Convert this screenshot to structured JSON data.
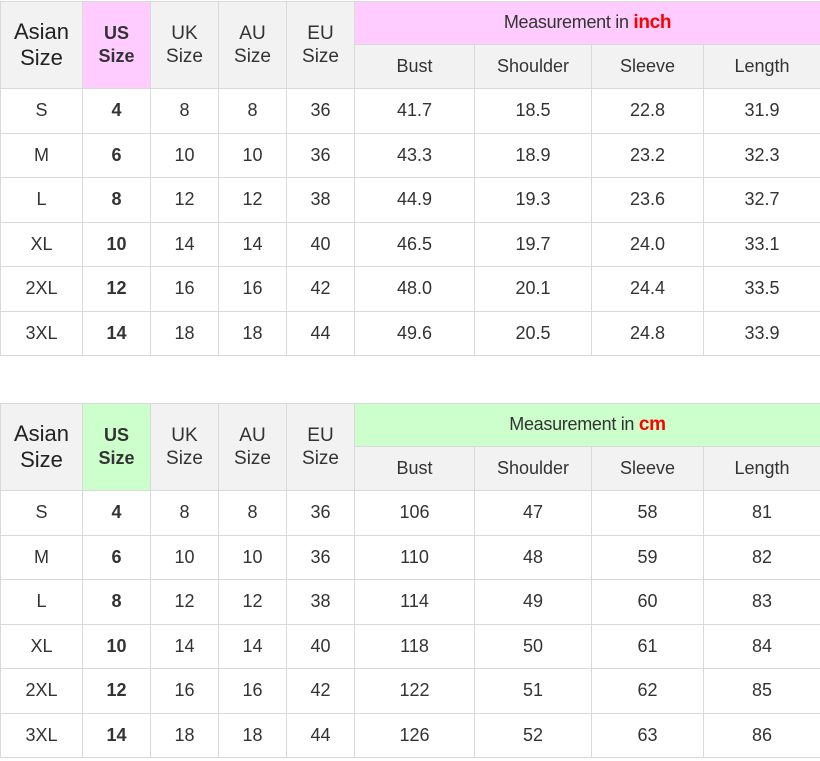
{
  "colors": {
    "inch_accent": "#ffccff",
    "cm_accent": "#ccffcc",
    "unit_text": "#ff0000",
    "header_bg": "#f2f2f2",
    "border": "#d9d9d9"
  },
  "headers": {
    "asian": [
      "Asian",
      "Size"
    ],
    "us": [
      "US",
      "Size"
    ],
    "uk": [
      "UK",
      "Size"
    ],
    "au": [
      "AU",
      "Size"
    ],
    "eu": [
      "EU",
      "Size"
    ],
    "measurement_prefix": "Measurement in ",
    "columns": [
      "Bust",
      "Shoulder",
      "Sleeve",
      "Length"
    ]
  },
  "tables": [
    {
      "unit": "inch",
      "rows": [
        [
          "S",
          "4",
          "8",
          "8",
          "36",
          "41.7",
          "18.5",
          "22.8",
          "31.9"
        ],
        [
          "M",
          "6",
          "10",
          "10",
          "36",
          "43.3",
          "18.9",
          "23.2",
          "32.3"
        ],
        [
          "L",
          "8",
          "12",
          "12",
          "38",
          "44.9",
          "19.3",
          "23.6",
          "32.7"
        ],
        [
          "XL",
          "10",
          "14",
          "14",
          "40",
          "46.5",
          "19.7",
          "24.0",
          "33.1"
        ],
        [
          "2XL",
          "12",
          "16",
          "16",
          "42",
          "48.0",
          "20.1",
          "24.4",
          "33.5"
        ],
        [
          "3XL",
          "14",
          "18",
          "18",
          "44",
          "49.6",
          "20.5",
          "24.8",
          "33.9"
        ]
      ]
    },
    {
      "unit": "cm",
      "rows": [
        [
          "S",
          "4",
          "8",
          "8",
          "36",
          "106",
          "47",
          "58",
          "81"
        ],
        [
          "M",
          "6",
          "10",
          "10",
          "36",
          "110",
          "48",
          "59",
          "82"
        ],
        [
          "L",
          "8",
          "12",
          "12",
          "38",
          "114",
          "49",
          "60",
          "83"
        ],
        [
          "XL",
          "10",
          "14",
          "14",
          "40",
          "118",
          "50",
          "61",
          "84"
        ],
        [
          "2XL",
          "12",
          "16",
          "16",
          "42",
          "122",
          "51",
          "62",
          "85"
        ],
        [
          "3XL",
          "14",
          "18",
          "18",
          "44",
          "126",
          "52",
          "63",
          "86"
        ]
      ]
    }
  ]
}
